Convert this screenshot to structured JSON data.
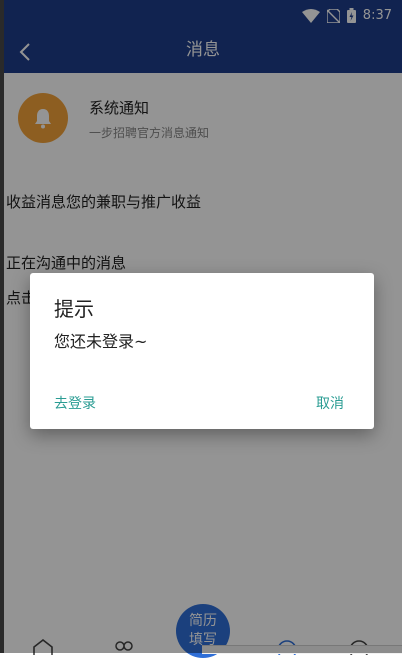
{
  "status_bar": {
    "time": "8:37"
  },
  "header": {
    "title": "消息"
  },
  "system_notice": {
    "title": "系统通知",
    "subtitle": "一步招聘官方消息通知"
  },
  "messages": {
    "income": "收益消息您的兼职与推广收益",
    "chatting": "正在沟通中的消息",
    "tap_hint": "点击"
  },
  "bottom_nav": {
    "resume_line1": "简历",
    "resume_line2": "填写"
  },
  "dialog": {
    "title": "提示",
    "message": "您还未登录~",
    "login_label": "去登录",
    "cancel_label": "取消"
  },
  "colors": {
    "header": "#1e3d8a",
    "accent": "#2a9c93",
    "bell": "#f3a23a",
    "resume": "#2f6fd8"
  }
}
